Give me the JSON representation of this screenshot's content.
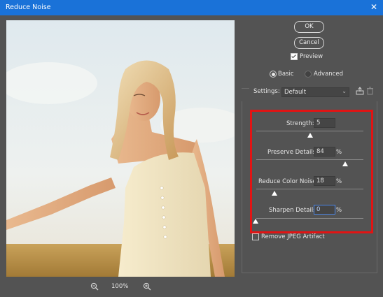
{
  "window": {
    "title": "Reduce Noise"
  },
  "zoom": {
    "level": "100%"
  },
  "buttons": {
    "ok": "OK",
    "cancel": "Cancel"
  },
  "preview_toggle": {
    "label": "Preview",
    "checked": true
  },
  "mode": {
    "basic": "Basic",
    "advanced": "Advanced",
    "selected": "Basic"
  },
  "settings": {
    "label": "Settings:",
    "value": "Default"
  },
  "controls": {
    "strength": {
      "label": "Strength:",
      "value": "5",
      "unit": ""
    },
    "preserve_details": {
      "label": "Preserve Details:",
      "value": "84",
      "unit": "%"
    },
    "reduce_color_noise": {
      "label": "Reduce Color Noise:",
      "value": "18",
      "unit": "%"
    },
    "sharpen_details": {
      "label": "Sharpen Details:",
      "value": "0",
      "unit": "%"
    }
  },
  "remove_jpeg": {
    "label": "Remove JPEG Artifact",
    "checked": false
  },
  "colors": {
    "titlebar": "#1a72d8",
    "dialog_bg": "#535353",
    "highlight_border": "#e11414"
  },
  "icons": {
    "close": "close-icon",
    "zoom_out": "zoom-out-icon",
    "zoom_in": "zoom-in-icon",
    "save_preset": "save-preset-icon",
    "delete_preset": "trash-icon"
  }
}
